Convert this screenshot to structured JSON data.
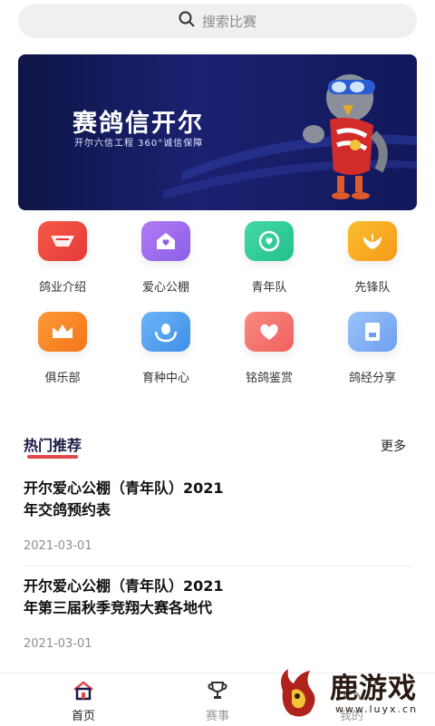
{
  "search": {
    "placeholder": "搜索比赛",
    "icon": "search-icon"
  },
  "banner": {
    "title": "赛鸽信开尔",
    "subtitle": "开尔六信工程   360°诚信保障"
  },
  "categories": [
    {
      "label": "鸽业介绍",
      "icon": "brand-logo-icon",
      "color": "#ee4b43"
    },
    {
      "label": "爱心公棚",
      "icon": "heart-house-icon",
      "color": "#9a6ff0"
    },
    {
      "label": "青年队",
      "icon": "smile-heart-icon",
      "color": "#2fcf9a"
    },
    {
      "label": "先锋队",
      "icon": "wings-icon",
      "color": "#f6a51e"
    },
    {
      "label": "俱乐部",
      "icon": "crown-icon",
      "color": "#f7851f"
    },
    {
      "label": "育种中心",
      "icon": "hands-egg-icon",
      "color": "#4e9ff0"
    },
    {
      "label": "铭鸽鉴赏",
      "icon": "heart-tag-icon",
      "color": "#f36b6b"
    },
    {
      "label": "鸽经分享",
      "icon": "book-icon",
      "color": "#72a8f5"
    }
  ],
  "section": {
    "title": "热门推荐",
    "more": "更多"
  },
  "news": [
    {
      "title_line1": "开尔爱心公棚（青年队）2021",
      "title_line2": "年交鸽预约表",
      "date": "2021-03-01"
    },
    {
      "title_line1": "开尔爱心公棚（青年队）2021",
      "title_line2": "年第三届秋季竞翔大赛各地代",
      "date": "2021-03-01"
    }
  ],
  "tabs": [
    {
      "label": "首页",
      "icon": "home-icon",
      "active": true
    },
    {
      "label": "赛事",
      "icon": "trophy-icon",
      "active": false
    },
    {
      "label": "我的",
      "icon": "user-icon",
      "active": false
    }
  ],
  "watermark": {
    "text": "鹿游戏",
    "url": "www.luyx.cn"
  },
  "colors": {
    "accent": "#e0484a",
    "active_tab": "#222222",
    "inactive_tab": "#9a9a9a"
  }
}
